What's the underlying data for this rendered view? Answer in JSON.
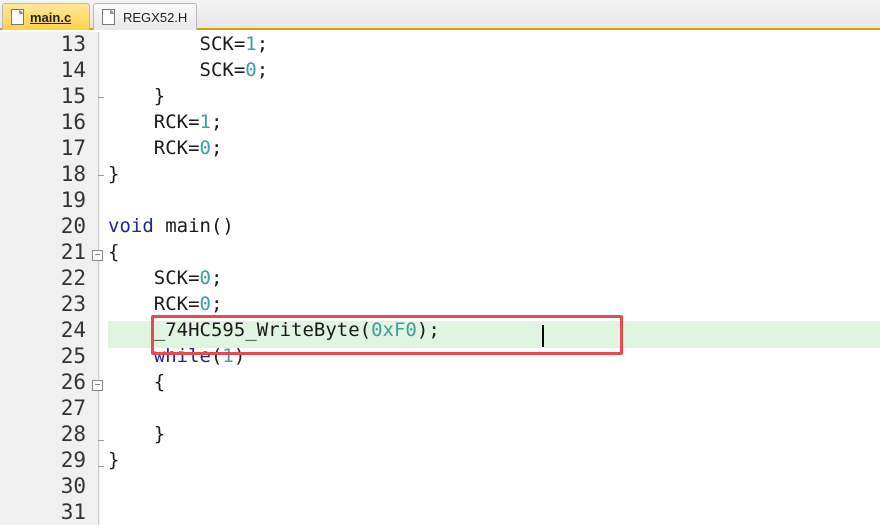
{
  "tabs": [
    {
      "label": "main.c",
      "active": true
    },
    {
      "label": "REGX52.H",
      "active": false
    }
  ],
  "lines": [
    {
      "num": "13",
      "code": "        SCK=1;"
    },
    {
      "num": "14",
      "code": "        SCK=0;"
    },
    {
      "num": "15",
      "code": "    }"
    },
    {
      "num": "16",
      "code": "    RCK=1;"
    },
    {
      "num": "17",
      "code": "    RCK=0;"
    },
    {
      "num": "18",
      "code": "}"
    },
    {
      "num": "19",
      "code": ""
    },
    {
      "num": "20",
      "code": "void main()"
    },
    {
      "num": "21",
      "code": "{"
    },
    {
      "num": "22",
      "code": "    SCK=0;"
    },
    {
      "num": "23",
      "code": "    RCK=0;"
    },
    {
      "num": "24",
      "code": "    _74HC595_WriteByte(0xF0);"
    },
    {
      "num": "25",
      "code": "    while(1)"
    },
    {
      "num": "26",
      "code": "    {"
    },
    {
      "num": "27",
      "code": ""
    },
    {
      "num": "28",
      "code": "    }"
    },
    {
      "num": "29",
      "code": "}"
    },
    {
      "num": "30",
      "code": ""
    },
    {
      "num": "31",
      "code": ""
    }
  ],
  "current_line": "24",
  "colors": {
    "keyword": "#1c2a8a",
    "number": "#3aa0a0",
    "highlight_border": "#e84b4b",
    "current_line_bg": "#dff5df",
    "active_tab": "#ffd24a"
  }
}
